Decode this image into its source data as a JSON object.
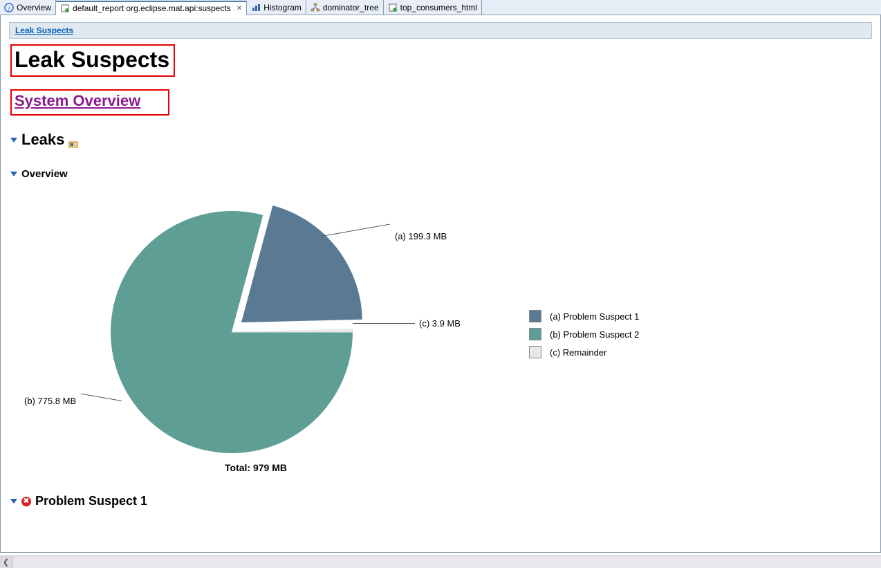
{
  "tabs": [
    {
      "label": "Overview"
    },
    {
      "label": "default_report  org.eclipse.mat.api:suspects"
    },
    {
      "label": "Histogram"
    },
    {
      "label": "dominator_tree"
    },
    {
      "label": "top_consumers_html"
    }
  ],
  "breadcrumb": {
    "link": "Leak Suspects"
  },
  "page_title": "Leak Suspects",
  "system_overview": "System Overview",
  "sections": {
    "leaks": "Leaks",
    "overview": "Overview",
    "problem1": "Problem Suspect 1"
  },
  "chart_total": "Total: 979 MB",
  "callouts": {
    "a": "(a)  199.3 MB",
    "b": "(b)  775.8 MB",
    "c": "(c)  3.9 MB"
  },
  "legend": {
    "a": "(a)  Problem Suspect 1",
    "b": "(b)  Problem Suspect 2",
    "c": "(c)  Remainder"
  },
  "colors": {
    "a": "#5a7a93",
    "b": "#5f9e95",
    "c": "#e8e8e8"
  },
  "chart_data": {
    "type": "pie",
    "title": "Leak Suspects Overview",
    "total_label": "Total: 979 MB",
    "unit": "MB",
    "series": [
      {
        "key": "a",
        "name": "Problem Suspect 1",
        "value": 199.3,
        "color": "#5a7a93",
        "exploded": true
      },
      {
        "key": "b",
        "name": "Problem Suspect 2",
        "value": 775.8,
        "color": "#5f9e95",
        "exploded": false
      },
      {
        "key": "c",
        "name": "Remainder",
        "value": 3.9,
        "color": "#e8e8e8",
        "exploded": false
      }
    ]
  }
}
